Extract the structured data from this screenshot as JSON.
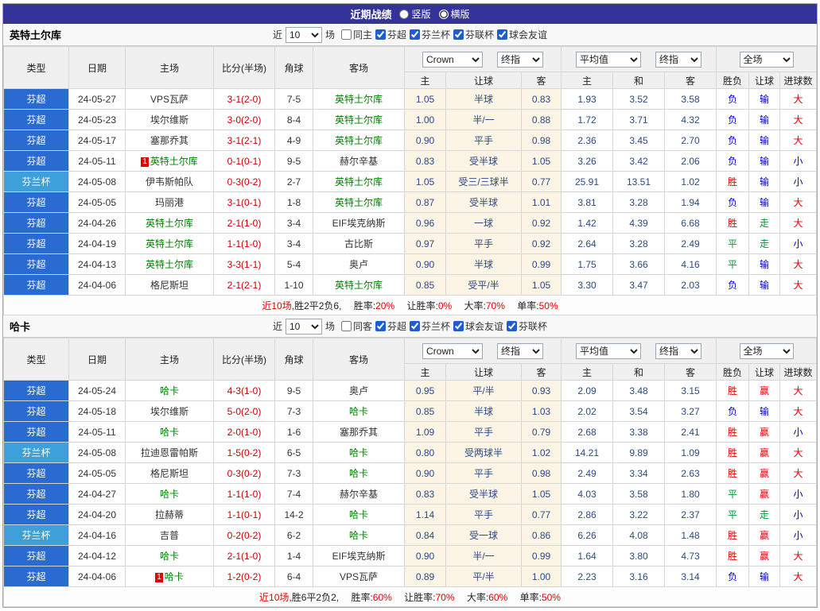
{
  "topbar": {
    "title": "近期战绩",
    "view_options": [
      {
        "label": "竖版",
        "selected": false
      },
      {
        "label": "横版",
        "selected": true
      }
    ]
  },
  "filter_labels": {
    "near": "近",
    "games_count": "10",
    "games": "场"
  },
  "table_header": {
    "col_type": "类型",
    "col_date": "日期",
    "col_home": "主场",
    "col_score": "比分(半场)",
    "col_corner": "角球",
    "col_away": "客场",
    "asian_select1": "Crown",
    "asian_select2": "终指",
    "euro_select1": "平均值",
    "euro_select2": "终指",
    "result_select": "全场",
    "sub_home": "主",
    "sub_handicap": "让球",
    "sub_away": "客",
    "sub_home2": "主",
    "sub_draw": "和",
    "sub_away2": "客",
    "sub_result": "胜负",
    "sub_handicap_result": "让球",
    "sub_goals": "进球数"
  },
  "colors": {
    "league": {
      "芬超": "#2a6bd2",
      "芬兰杯": "#3da0d8"
    },
    "result": {
      "胜": "#e60000",
      "平": "#009933",
      "负": "#0000cc",
      "赢": "#e60000",
      "走": "#009933",
      "输": "#0000cc",
      "大": "#e60000",
      "小": "#0000cc"
    },
    "score": "#cc0000",
    "focus_team": "#008000"
  },
  "teams": [
    {
      "name": "英特土尔库",
      "filters": [
        {
          "label": "同主",
          "checked": false
        },
        {
          "label": "芬超",
          "checked": true
        },
        {
          "label": "芬兰杯",
          "checked": true
        },
        {
          "label": "芬联杯",
          "checked": true
        },
        {
          "label": "球会友谊",
          "checked": true
        }
      ],
      "rows": [
        {
          "league": "芬超",
          "date": "24-05-27",
          "home": "VPS瓦萨",
          "away": "英特土尔库",
          "focus": "away",
          "home_card": null,
          "away_card": null,
          "score": "3-1(2-0)",
          "corner": "7-5",
          "asian": [
            "1.05",
            "半球",
            "0.83"
          ],
          "euro": [
            "1.93",
            "3.52",
            "3.58"
          ],
          "result": [
            "负",
            "输",
            "大"
          ]
        },
        {
          "league": "芬超",
          "date": "24-05-23",
          "home": "埃尔维斯",
          "away": "英特土尔库",
          "focus": "away",
          "home_card": null,
          "away_card": null,
          "score": "3-0(2-0)",
          "corner": "8-4",
          "asian": [
            "1.00",
            "半/一",
            "0.88"
          ],
          "euro": [
            "1.72",
            "3.71",
            "4.32"
          ],
          "result": [
            "负",
            "输",
            "大"
          ]
        },
        {
          "league": "芬超",
          "date": "24-05-17",
          "home": "塞那乔其",
          "away": "英特土尔库",
          "focus": "away",
          "home_card": null,
          "away_card": null,
          "score": "3-1(2-1)",
          "corner": "4-9",
          "asian": [
            "0.90",
            "平手",
            "0.98"
          ],
          "euro": [
            "2.36",
            "3.45",
            "2.70"
          ],
          "result": [
            "负",
            "输",
            "大"
          ]
        },
        {
          "league": "芬超",
          "date": "24-05-11",
          "home": "英特土尔库",
          "away": "赫尔辛基",
          "focus": "home",
          "home_card": "1",
          "away_card": null,
          "score": "0-1(0-1)",
          "corner": "9-5",
          "asian": [
            "0.83",
            "受半球",
            "1.05"
          ],
          "euro": [
            "3.26",
            "3.42",
            "2.06"
          ],
          "result": [
            "负",
            "输",
            "小"
          ]
        },
        {
          "league": "芬兰杯",
          "date": "24-05-08",
          "home": "伊韦斯帕队",
          "away": "英特土尔库",
          "focus": "away",
          "home_card": null,
          "away_card": null,
          "score": "0-3(0-2)",
          "corner": "2-7",
          "asian": [
            "1.05",
            "受三/三球半",
            "0.77"
          ],
          "euro": [
            "25.91",
            "13.51",
            "1.02"
          ],
          "result": [
            "胜",
            "输",
            "小"
          ]
        },
        {
          "league": "芬超",
          "date": "24-05-05",
          "home": "玛丽港",
          "away": "英特土尔库",
          "focus": "away",
          "home_card": null,
          "away_card": null,
          "score": "3-1(0-1)",
          "corner": "1-8",
          "asian": [
            "0.87",
            "受半球",
            "1.01"
          ],
          "euro": [
            "3.81",
            "3.28",
            "1.94"
          ],
          "result": [
            "负",
            "输",
            "大"
          ]
        },
        {
          "league": "芬超",
          "date": "24-04-26",
          "home": "英特土尔库",
          "away": "EIF埃克纳斯",
          "focus": "home",
          "home_card": null,
          "away_card": null,
          "score": "2-1(1-0)",
          "corner": "3-4",
          "asian": [
            "0.96",
            "一球",
            "0.92"
          ],
          "euro": [
            "1.42",
            "4.39",
            "6.68"
          ],
          "result": [
            "胜",
            "走",
            "大"
          ]
        },
        {
          "league": "芬超",
          "date": "24-04-19",
          "home": "英特土尔库",
          "away": "古比斯",
          "focus": "home",
          "home_card": null,
          "away_card": null,
          "score": "1-1(1-0)",
          "corner": "3-4",
          "asian": [
            "0.97",
            "平手",
            "0.92"
          ],
          "euro": [
            "2.64",
            "3.28",
            "2.49"
          ],
          "result": [
            "平",
            "走",
            "小"
          ]
        },
        {
          "league": "芬超",
          "date": "24-04-13",
          "home": "英特土尔库",
          "away": "奥卢",
          "focus": "home",
          "home_card": null,
          "away_card": null,
          "score": "3-3(1-1)",
          "corner": "5-4",
          "asian": [
            "0.90",
            "半球",
            "0.99"
          ],
          "euro": [
            "1.75",
            "3.66",
            "4.16"
          ],
          "result": [
            "平",
            "输",
            "大"
          ]
        },
        {
          "league": "芬超",
          "date": "24-04-06",
          "home": "格尼斯坦",
          "away": "英特土尔库",
          "focus": "away",
          "home_card": null,
          "away_card": null,
          "score": "2-1(2-1)",
          "corner": "1-10",
          "asian": [
            "0.85",
            "受平/半",
            "1.05"
          ],
          "euro": [
            "3.30",
            "3.47",
            "2.03"
          ],
          "result": [
            "负",
            "输",
            "大"
          ]
        }
      ],
      "summary": {
        "games": "近10场",
        "record": ",胜2平2负6,",
        "stats": [
          {
            "label": "胜率:",
            "value": "20%"
          },
          {
            "label": "让胜率:",
            "value": "0%"
          },
          {
            "label": "大率:",
            "value": "70%"
          },
          {
            "label": "单率:",
            "value": "50%"
          }
        ]
      }
    },
    {
      "name": "哈卡",
      "filters": [
        {
          "label": "同客",
          "checked": false
        },
        {
          "label": "芬超",
          "checked": true
        },
        {
          "label": "芬兰杯",
          "checked": true
        },
        {
          "label": "球会友谊",
          "checked": true
        },
        {
          "label": "芬联杯",
          "checked": true
        }
      ],
      "rows": [
        {
          "league": "芬超",
          "date": "24-05-24",
          "home": "哈卡",
          "away": "奥卢",
          "focus": "home",
          "home_card": null,
          "away_card": null,
          "score": "4-3(1-0)",
          "corner": "9-5",
          "asian": [
            "0.95",
            "平/半",
            "0.93"
          ],
          "euro": [
            "2.09",
            "3.48",
            "3.15"
          ],
          "result": [
            "胜",
            "赢",
            "大"
          ]
        },
        {
          "league": "芬超",
          "date": "24-05-18",
          "home": "埃尔维斯",
          "away": "哈卡",
          "focus": "away",
          "home_card": null,
          "away_card": null,
          "score": "5-0(2-0)",
          "corner": "7-3",
          "asian": [
            "0.85",
            "半球",
            "1.03"
          ],
          "euro": [
            "2.02",
            "3.54",
            "3.27"
          ],
          "result": [
            "负",
            "输",
            "大"
          ]
        },
        {
          "league": "芬超",
          "date": "24-05-11",
          "home": "哈卡",
          "away": "塞那乔其",
          "focus": "home",
          "home_card": null,
          "away_card": null,
          "score": "2-0(1-0)",
          "corner": "1-6",
          "asian": [
            "1.09",
            "平手",
            "0.79"
          ],
          "euro": [
            "2.68",
            "3.38",
            "2.41"
          ],
          "result": [
            "胜",
            "赢",
            "小"
          ]
        },
        {
          "league": "芬兰杯",
          "date": "24-05-08",
          "home": "拉迪恩雷帕斯",
          "away": "哈卡",
          "focus": "away",
          "home_card": null,
          "away_card": null,
          "score": "1-5(0-2)",
          "corner": "6-5",
          "asian": [
            "0.80",
            "受两球半",
            "1.02"
          ],
          "euro": [
            "14.21",
            "9.89",
            "1.09"
          ],
          "result": [
            "胜",
            "赢",
            "大"
          ]
        },
        {
          "league": "芬超",
          "date": "24-05-05",
          "home": "格尼斯坦",
          "away": "哈卡",
          "focus": "away",
          "home_card": null,
          "away_card": null,
          "score": "0-3(0-2)",
          "corner": "7-3",
          "asian": [
            "0.90",
            "平手",
            "0.98"
          ],
          "euro": [
            "2.49",
            "3.34",
            "2.63"
          ],
          "result": [
            "胜",
            "赢",
            "大"
          ]
        },
        {
          "league": "芬超",
          "date": "24-04-27",
          "home": "哈卡",
          "away": "赫尔辛基",
          "focus": "home",
          "home_card": null,
          "away_card": null,
          "score": "1-1(1-0)",
          "corner": "7-4",
          "asian": [
            "0.83",
            "受半球",
            "1.05"
          ],
          "euro": [
            "4.03",
            "3.58",
            "1.80"
          ],
          "result": [
            "平",
            "赢",
            "小"
          ]
        },
        {
          "league": "芬超",
          "date": "24-04-20",
          "home": "拉赫蒂",
          "away": "哈卡",
          "focus": "away",
          "home_card": null,
          "away_card": null,
          "score": "1-1(0-1)",
          "corner": "14-2",
          "asian": [
            "1.14",
            "平手",
            "0.77"
          ],
          "euro": [
            "2.86",
            "3.22",
            "2.37"
          ],
          "result": [
            "平",
            "走",
            "小"
          ]
        },
        {
          "league": "芬兰杯",
          "date": "24-04-16",
          "home": "吉普",
          "away": "哈卡",
          "focus": "away",
          "home_card": null,
          "away_card": null,
          "score": "0-2(0-2)",
          "corner": "6-2",
          "asian": [
            "0.84",
            "受一球",
            "0.86"
          ],
          "euro": [
            "6.26",
            "4.08",
            "1.48"
          ],
          "result": [
            "胜",
            "赢",
            "小"
          ]
        },
        {
          "league": "芬超",
          "date": "24-04-12",
          "home": "哈卡",
          "away": "EIF埃克纳斯",
          "focus": "home",
          "home_card": null,
          "away_card": null,
          "score": "2-1(1-0)",
          "corner": "1-4",
          "asian": [
            "0.90",
            "半/一",
            "0.99"
          ],
          "euro": [
            "1.64",
            "3.80",
            "4.73"
          ],
          "result": [
            "胜",
            "赢",
            "大"
          ]
        },
        {
          "league": "芬超",
          "date": "24-04-06",
          "home": "哈卡",
          "away": "VPS瓦萨",
          "focus": "home",
          "home_card": "1",
          "away_card": null,
          "score": "1-2(0-2)",
          "corner": "6-4",
          "asian": [
            "0.89",
            "平/半",
            "1.00"
          ],
          "euro": [
            "2.23",
            "3.16",
            "3.14"
          ],
          "result": [
            "负",
            "输",
            "大"
          ]
        }
      ],
      "summary": {
        "games": "近10场",
        "record": ",胜6平2负2,",
        "stats": [
          {
            "label": "胜率:",
            "value": "60%"
          },
          {
            "label": "让胜率:",
            "value": "70%"
          },
          {
            "label": "大率:",
            "value": "60%"
          },
          {
            "label": "单率:",
            "value": "50%"
          }
        ]
      }
    }
  ]
}
